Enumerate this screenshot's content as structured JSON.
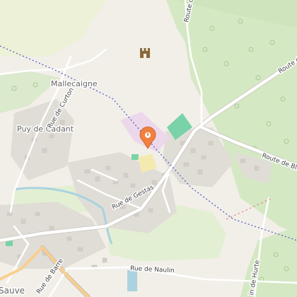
{
  "map": {
    "places": {
      "mallecaigne": "Mallecaigne",
      "puy_de_cadant": "Puy de Cadant",
      "sauve": "Sauve"
    },
    "streets": {
      "rue_de_gestas": "Rue de Gestas",
      "rue_de_curton": "Rue de Curton",
      "rue_de_barre": "Rue de Barre",
      "rue_de_naulin": "Rue de Naulin",
      "route_de_ble": "Route de Ble",
      "route_top_left": "Route de",
      "route_top_right": "Route de",
      "chemin_de_hurte": "in de Hurte"
    },
    "markers": {
      "location_pin": "location-pin-icon",
      "castle": "castle-icon"
    },
    "colors": {
      "land": "#f2efe9",
      "forest": "#d3e6c2",
      "meadow": "#e3efd3",
      "residential": "#e0ddd7",
      "building": "#d3cec7",
      "road": "#ffffff",
      "pin": "#f08040",
      "sports": "#79d2a8",
      "water": "#aad3df",
      "highlight": "#ecd8ea",
      "railway_dotted": "#4a55c8"
    }
  }
}
